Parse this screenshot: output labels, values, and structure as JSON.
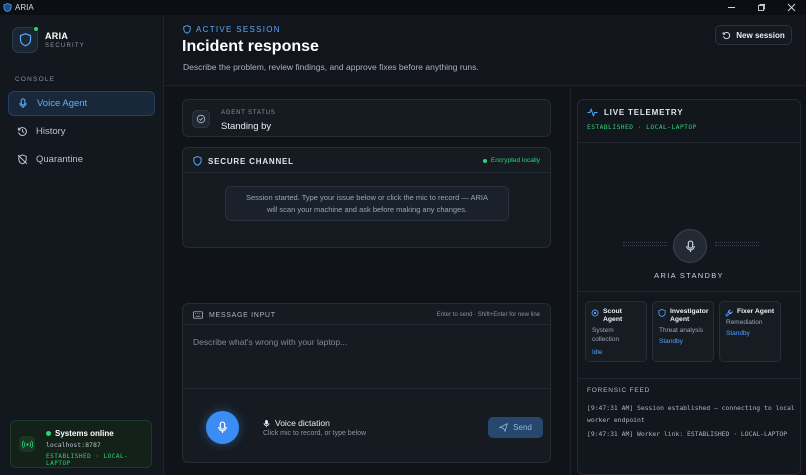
{
  "window": {
    "title": "ARIA"
  },
  "sidebar": {
    "brand_name": "ARIA",
    "brand_sub": "SECURITY",
    "section_label": "CONSOLE",
    "items": [
      {
        "label": "Voice Agent",
        "icon": "mic-icon",
        "active": true
      },
      {
        "label": "History",
        "icon": "history-icon",
        "active": false
      },
      {
        "label": "Quarantine",
        "icon": "shield-off-icon",
        "active": false
      }
    ],
    "status": {
      "title": "Systems online",
      "host": "localhost:8787",
      "connection": "ESTABLISHED · LOCAL-LAPTOP"
    }
  },
  "header": {
    "kicker": "ACTIVE SESSION",
    "title": "Incident response",
    "subtitle": "Describe the problem, review findings, and approve fixes before anything runs.",
    "new_session_label": "New session"
  },
  "agent_status": {
    "label": "AGENT STATUS",
    "value": "Standing by"
  },
  "secure_channel": {
    "title": "SECURE CHANNEL",
    "badge": "Encrypted locally",
    "message_line1": "Session started. Type your issue below or click the mic to record — ARIA",
    "message_line2": "will scan your machine and ask before making any changes."
  },
  "composer": {
    "title": "MESSAGE INPUT",
    "hint": "Enter to send · Shift+Enter for new line",
    "placeholder": "Describe what's wrong with your laptop...",
    "voice_title": "Voice dictation",
    "voice_sub": "Click mic to record, or type below",
    "send_label": "Send"
  },
  "telemetry": {
    "title": "LIVE TELEMETRY",
    "connection": "ESTABLISHED · LOCAL-LAPTOP",
    "standby_label": "ARIA STANDBY",
    "agents": [
      {
        "name_line1": "Scout",
        "name_line2": "Agent",
        "role_line1": "System",
        "role_line2": "collection",
        "status": "Idle",
        "icon": "scout-icon"
      },
      {
        "name_line1": "Investigator",
        "name_line2": "Agent",
        "role_line1": "Threat analysis",
        "role_line2": "",
        "status": "Standby",
        "icon": "investigator-icon"
      },
      {
        "name_line1": "Fixer Agent",
        "name_line2": "",
        "role_line1": "Remediation",
        "role_line2": "",
        "status": "Standby",
        "icon": "fixer-icon"
      }
    ],
    "feed_title": "FORENSIC FEED",
    "feed": [
      "[9:47:31 AM] Session established — connecting to local worker endpoint",
      "[9:47:31 AM] Worker link: ESTABLISHED · LOCAL-LAPTOP"
    ]
  },
  "colors": {
    "accent": "#3b8df5",
    "success": "#2bd576",
    "background": "#0f1318"
  }
}
